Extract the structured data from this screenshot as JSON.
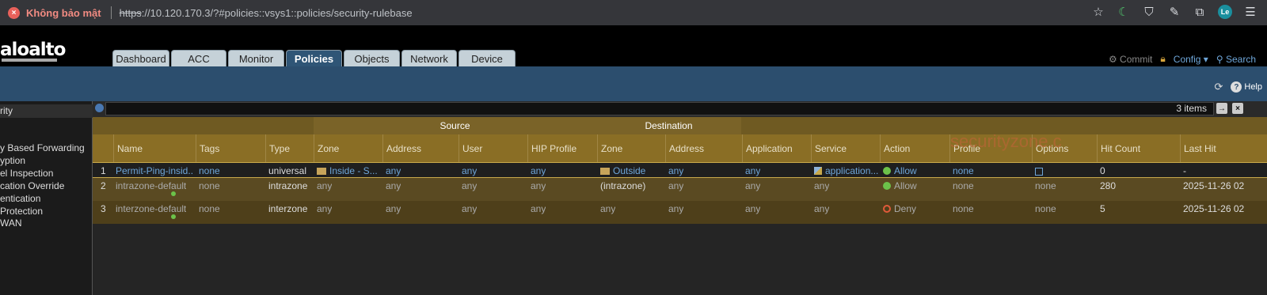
{
  "browser": {
    "security_label": "Không bảo mật",
    "url_scheme": "https",
    "url_rest": "://10.120.170.3/?#policies::vsys1::policies/security-rulebase",
    "profile_initials": "Le"
  },
  "header": {
    "logo": "aloalto",
    "tabs": [
      "Dashboard",
      "ACC",
      "Monitor",
      "Policies",
      "Objects",
      "Network",
      "Device"
    ],
    "active_tab": "Policies",
    "commit": "Commit",
    "config": "Config",
    "search": "Search",
    "help": "Help"
  },
  "sidebar": {
    "section": "rity",
    "items": [
      "y Based Forwarding",
      "yption",
      "el Inspection",
      "cation Override",
      "entication",
      "Protection",
      "WAN"
    ]
  },
  "filter": {
    "items_count": "3 items"
  },
  "grid": {
    "groups": {
      "source": "Source",
      "destination": "Destination"
    },
    "columns": [
      "Name",
      "Tags",
      "Type",
      "Zone",
      "Address",
      "User",
      "HIP Profile",
      "Zone",
      "Address",
      "Application",
      "Service",
      "Action",
      "Profile",
      "Options",
      "Hit Count",
      "Last Hit"
    ],
    "rows": [
      {
        "num": "1",
        "name": "Permit-Ping-insid...",
        "tags": "none",
        "type": "universal",
        "src_zone": "Inside - S...",
        "src_addr": "any",
        "user": "any",
        "hip": "any",
        "dst_zone": "Outside",
        "dst_addr": "any",
        "app": "any",
        "service": "application...",
        "action": "Allow",
        "profile": "none",
        "options": "",
        "hits": "0",
        "last_hit": "-"
      },
      {
        "num": "2",
        "name": "intrazone-default",
        "tags": "none",
        "type": "intrazone",
        "src_zone": "any",
        "src_addr": "any",
        "user": "any",
        "hip": "any",
        "dst_zone": "(intrazone)",
        "dst_addr": "any",
        "app": "any",
        "service": "any",
        "action": "Allow",
        "profile": "none",
        "options": "none",
        "hits": "280",
        "last_hit": "2025-11-26 02"
      },
      {
        "num": "3",
        "name": "interzone-default",
        "tags": "none",
        "type": "interzone",
        "src_zone": "any",
        "src_addr": "any",
        "user": "any",
        "hip": "any",
        "dst_zone": "any",
        "dst_addr": "any",
        "app": "any",
        "service": "any",
        "action": "Deny",
        "profile": "none",
        "options": "none",
        "hits": "5",
        "last_hit": "2025-11-26 02"
      }
    ]
  },
  "watermark": "securityzone.c"
}
